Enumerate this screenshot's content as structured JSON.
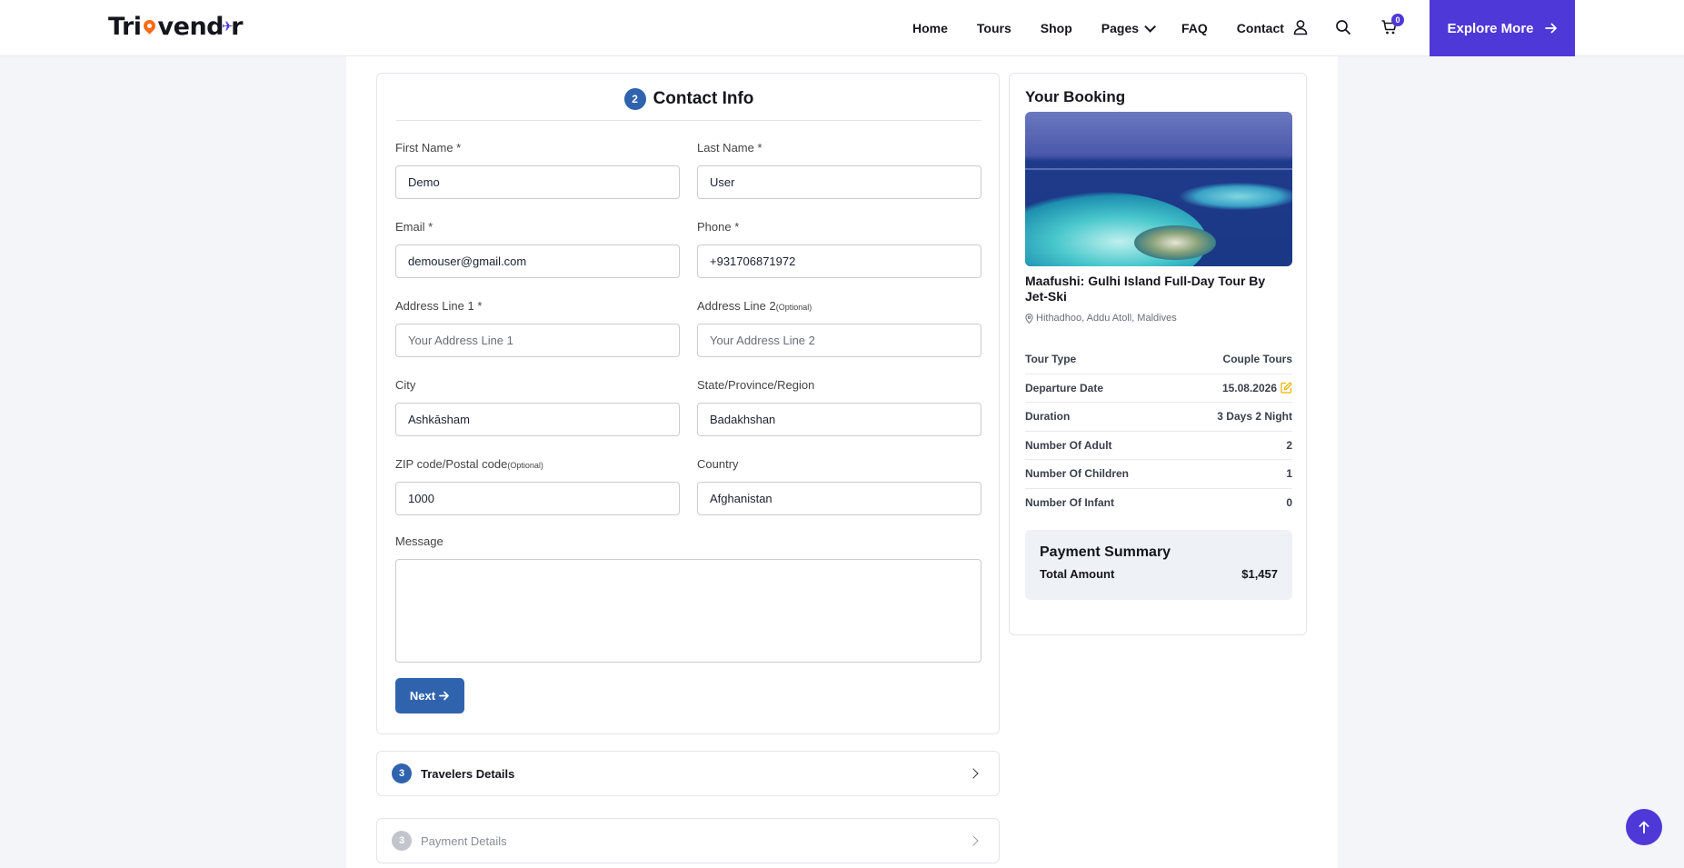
{
  "brand": {
    "logo_text_a": "Tri",
    "logo_text_b": "vend",
    "logo_text_c": "r"
  },
  "nav": {
    "items": [
      "Home",
      "Tours",
      "Shop",
      "Pages",
      "FAQ",
      "Contact"
    ],
    "cart_count": "0",
    "explore_label": "Explore More"
  },
  "step2": {
    "number": "2",
    "title": "Contact Info",
    "fields": {
      "first_name": {
        "label": "First Name *",
        "value": "Demo",
        "placeholder": ""
      },
      "last_name": {
        "label": "Last Name *",
        "value": "User",
        "placeholder": ""
      },
      "email": {
        "label": "Email *",
        "value": "demouser@gmail.com",
        "placeholder": ""
      },
      "phone": {
        "label": "Phone *",
        "value": "+931706871972",
        "placeholder": ""
      },
      "address1": {
        "label": "Address Line 1 *",
        "value": "",
        "placeholder": "Your Address Line 1"
      },
      "address2": {
        "label": "Address Line 2",
        "optional": "(Optional)",
        "value": "",
        "placeholder": "Your Address Line 2"
      },
      "city": {
        "label": "City",
        "value": "Ashkāsham",
        "placeholder": ""
      },
      "state": {
        "label": "State/Province/Region",
        "value": "Badakhshan",
        "placeholder": ""
      },
      "zip": {
        "label": "ZIP code/Postal code",
        "optional": "(Optional)",
        "value": "1000",
        "placeholder": ""
      },
      "country": {
        "label": "Country",
        "value": "Afghanistan",
        "placeholder": ""
      },
      "message": {
        "label": "Message",
        "value": ""
      }
    },
    "next_label": "Next"
  },
  "step3": {
    "number": "3",
    "title": "Travelers Details"
  },
  "step4": {
    "number": "3",
    "title": "Payment Details"
  },
  "booking": {
    "title": "Your Booking",
    "tour_name": "Maafushi: Gulhi Island Full-Day Tour By Jet-Ski",
    "location": "Hithadhoo, Addu Atoll, Maldives",
    "rows": [
      {
        "label": "Tour Type",
        "value": "Couple Tours"
      },
      {
        "label": "Departure Date",
        "value": "15.08.2026"
      },
      {
        "label": "Duration",
        "value": "3 Days 2 Night"
      },
      {
        "label": "Number Of Adult",
        "value": "2"
      },
      {
        "label": "Number Of Children",
        "value": "1"
      },
      {
        "label": "Number Of Infant",
        "value": "0"
      }
    ],
    "payment": {
      "title": "Payment Summary",
      "total_label": "Total Amount",
      "total_value": "$1,457"
    }
  },
  "colors": {
    "accent": "#4f38d8",
    "primary": "#2f63ad",
    "edit_icon": "#f0b400"
  }
}
